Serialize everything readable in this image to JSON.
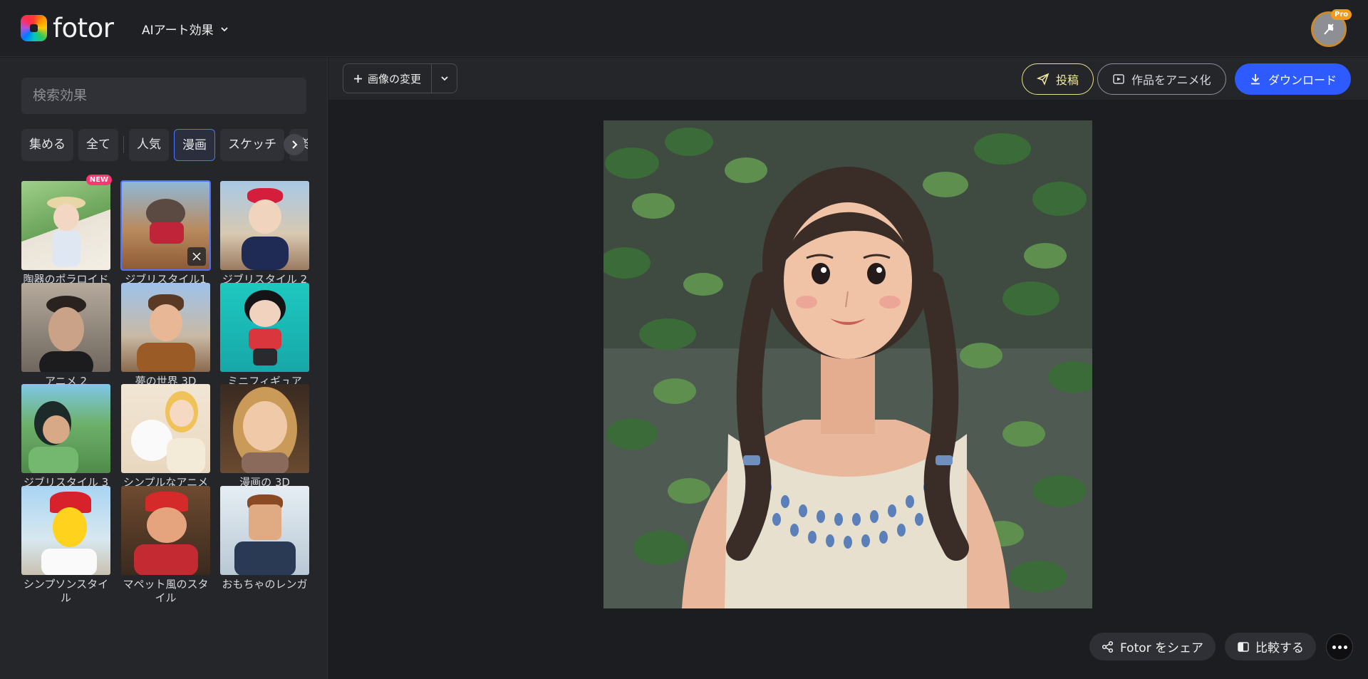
{
  "app": {
    "logo_text": "fotor",
    "menu_label": "AIアート効果"
  },
  "user": {
    "badge": "Pro"
  },
  "sidebar": {
    "search_placeholder": "検索効果",
    "chips": [
      {
        "label": "集める",
        "active": false
      },
      {
        "label": "全て",
        "active": false
      },
      {
        "label": "人気",
        "active": false
      },
      {
        "label": "漫画",
        "active": true
      },
      {
        "label": "スケッチ",
        "active": false
      },
      {
        "label": "楽",
        "active": false
      }
    ],
    "effects": [
      {
        "label": "陶器のポラロイド",
        "badge": "NEW"
      },
      {
        "label": "ジブリスタイル1",
        "selected": true
      },
      {
        "label": "ジブリスタイル 2"
      },
      {
        "label": "アニメ 2"
      },
      {
        "label": "夢の世界 3D"
      },
      {
        "label": "ミニフィギュア"
      },
      {
        "label": "ジブリスタイル 3"
      },
      {
        "label": "シンプルなアニメーションスタイル"
      },
      {
        "label": "漫画の 3D"
      },
      {
        "label": "シンプソンスタイル"
      },
      {
        "label": "マペット風のスタイル"
      },
      {
        "label": "おもちゃのレンガ"
      }
    ]
  },
  "toolbar": {
    "change_image_label": "画像の変更",
    "post_label": "投稿",
    "animate_label": "作品をアニメ化",
    "download_label": "ダウンロード"
  },
  "bottom": {
    "share_label": "Fotor をシェア",
    "compare_label": "比較する"
  },
  "colors": {
    "accent": "#2e5bff",
    "selected": "#4e74ff",
    "post": "#e8e28a",
    "pro": "#f49a1a"
  }
}
